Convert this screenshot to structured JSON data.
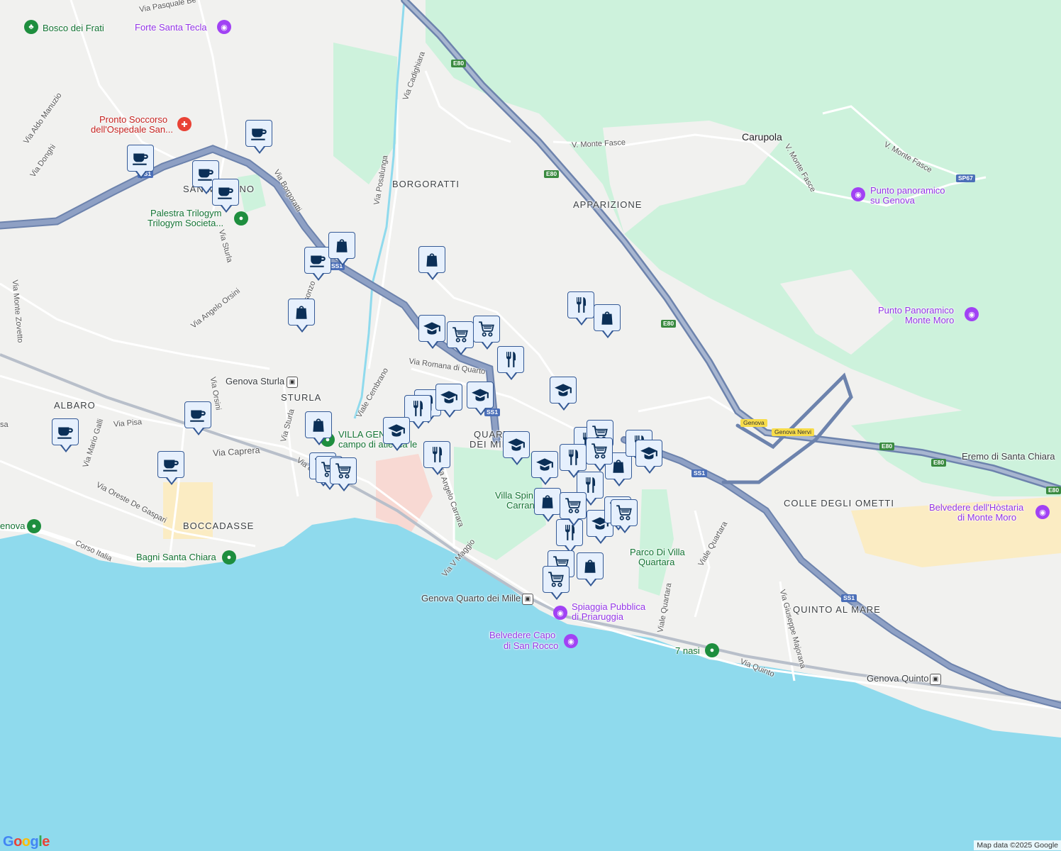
{
  "colors": {
    "water": "#8fdaed",
    "land": "#f1f1ef",
    "park": "#cdf2dc",
    "highway": "#7b8fb6",
    "beach": "#fbecc3"
  },
  "areas": {
    "borgoratti": "BORGORATTI",
    "apparizione": "APPARIZIONE",
    "sturla": "STURLA",
    "albaro": "ALBARO",
    "boccadasse": "BOCCADASSE",
    "quarto_1": "QUARTO",
    "quarto_2": "DEI MILLE",
    "colle_degli_ometti": "COLLE DEGLI OMETTI",
    "quinto_al_mare": "QUINTO AL MARE",
    "san_martino": "SAN MARTINO",
    "carupola": "Carupola"
  },
  "streets": {
    "via_pasquale": "Via Pasquale Be",
    "via_cadighiara": "Via Cadighiara",
    "via_aldo_manuzio": "Via Aldo Manuzio",
    "via_donghi": "Via Donghi",
    "via_borgoratti": "Via Borgoratti",
    "via_posalunga": "Via Posalunga",
    "v_monte_fasce_1": "V. Monte Fasce",
    "v_monte_fasce_2": "V. Monte Fasce",
    "v_monte_fasce_3": "V. Monte Fasce",
    "via_sturla_1": "Via Sturla",
    "via_angelo_orsini": "Via Angelo Orsini",
    "via_monte_zovetto": "Via Monte Zovetto",
    "isonzo": "Isonzo",
    "via_romana_di_quarto": "Via Romana di Quarto",
    "viale_cembrano": "Viale Cembrano",
    "via_orsini": "Via Orsini",
    "via_pisa": "Via Pisa",
    "via_mario_galli": "Via Mario Galli",
    "via_caprera": "Via Caprera",
    "via_sturla_2": "Via Sturla",
    "via_dei_mille": "Via dei Mille",
    "via_oreste_de_gaspari": "Via Oreste De Gaspari",
    "corso_italia": "Corso Italia",
    "via_angelo_carrara": "Via Angelo Carrara",
    "via_v_maggio": "Via V Maggio",
    "viale_quartara_1": "Viale Quartara",
    "viale_quartara_2": "Viale Quartara",
    "via_giuseppe_majorana": "Via Giuseppe Majorana",
    "via_quinto": "Via Quinto",
    "sa": "sa"
  },
  "shields": {
    "e80": "E80",
    "ss1": "SS1",
    "sp67": "SP67",
    "genova": "Genova",
    "genova_nervi": "Genova Nervi"
  },
  "pois": {
    "bosco_dei_frati": "Bosco dei Frati",
    "forte_santa_tecla": "Forte Santa Tecla",
    "pronto_soccorso": [
      "Pronto Soccorso",
      "dell'Ospedale San..."
    ],
    "palestra": [
      "Palestra Trilogym",
      "Trilogym Societa..."
    ],
    "punto_panoramico_genova": [
      "Punto panoramico",
      "su Genova"
    ],
    "punto_panoramico_monte_moro": [
      "Punto Panoramico",
      "Monte Moro"
    ],
    "eremo": "Eremo di Santa Chiara",
    "belvedere_hostaria": [
      "Belvedere dell'Hòstaria",
      "di Monte Moro"
    ],
    "villa_gentile": [
      "VILLA GEN",
      "campo di atletica le"
    ],
    "villa_spinola": [
      "Villa Spin",
      "Carran"
    ],
    "parco_villa_quartara": [
      "Parco Di Villa",
      "Quartara"
    ],
    "spiaggia": [
      "Spiaggia Pubblica",
      "di Priaruggia"
    ],
    "belvedere_capo": [
      "Belvedere Capo",
      "di San Rocco"
    ],
    "sette_nasi": "7 nasi",
    "genova_lbl": "enova",
    "bagni_santa_chiara": "Bagni Santa Chiara"
  },
  "stations": {
    "genova_sturla": "Genova Sturla",
    "genova_quarto": "Genova Quarto dei Mille",
    "genova_quinto": "Genova Quinto"
  },
  "markers": [
    {
      "type": "cafe"
    },
    {
      "type": "cafe"
    },
    {
      "type": "cafe"
    },
    {
      "type": "cafe"
    },
    {
      "type": "cafe"
    },
    {
      "type": "cafe"
    },
    {
      "type": "cafe"
    },
    {
      "type": "cafe"
    },
    {
      "type": "bag"
    },
    {
      "type": "bag"
    },
    {
      "type": "bag"
    },
    {
      "type": "bag"
    },
    {
      "type": "bag"
    },
    {
      "type": "bag"
    },
    {
      "type": "bag"
    },
    {
      "type": "bag"
    },
    {
      "type": "restaurant"
    },
    {
      "type": "restaurant"
    },
    {
      "type": "restaurant"
    },
    {
      "type": "restaurant"
    },
    {
      "type": "restaurant"
    },
    {
      "type": "restaurant"
    },
    {
      "type": "restaurant"
    },
    {
      "type": "restaurant"
    },
    {
      "type": "restaurant"
    },
    {
      "type": "restaurant"
    },
    {
      "type": "school"
    },
    {
      "type": "school"
    },
    {
      "type": "school"
    },
    {
      "type": "school"
    },
    {
      "type": "school"
    },
    {
      "type": "school"
    },
    {
      "type": "school"
    },
    {
      "type": "school"
    },
    {
      "type": "school"
    },
    {
      "type": "cart"
    },
    {
      "type": "cart"
    },
    {
      "type": "cart"
    },
    {
      "type": "cart"
    },
    {
      "type": "cart"
    },
    {
      "type": "cart"
    },
    {
      "type": "cart"
    },
    {
      "type": "cart"
    },
    {
      "type": "cart"
    },
    {
      "type": "cart"
    },
    {
      "type": "cart"
    },
    {
      "type": "cart"
    }
  ],
  "footer": {
    "google": "Google",
    "attribution": "Map data ©2025 Google"
  }
}
